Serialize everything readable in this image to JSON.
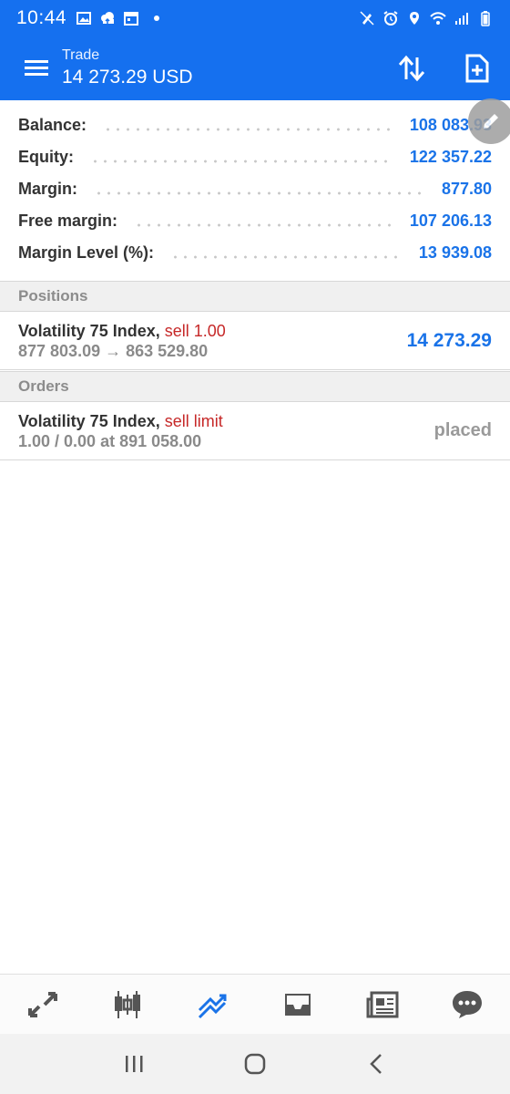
{
  "status_bar": {
    "time": "10:44",
    "left_icons": [
      "image-icon",
      "cloud-upload-icon",
      "calendar-icon",
      "notification-dot"
    ],
    "right_icons": [
      "no-pen-icon",
      "alarm-icon",
      "location-icon",
      "wifi-icon",
      "signal-icon",
      "battery-icon"
    ]
  },
  "toolbar": {
    "subtitle": "Trade",
    "title": "14 273.29 USD",
    "menu_icon": "hamburger-menu-icon",
    "sort_icon": "sort-arrows-icon",
    "new_order_icon": "new-document-icon",
    "accent_color": "#1570ef"
  },
  "summary": [
    {
      "label": "Balance:",
      "value": "108 083.93"
    },
    {
      "label": "Equity:",
      "value": "122 357.22"
    },
    {
      "label": "Margin:",
      "value": "877.80"
    },
    {
      "label": "Free margin:",
      "value": "107 206.13"
    },
    {
      "label": "Margin Level (%):",
      "value": "13 939.08"
    }
  ],
  "positions": {
    "header": "Positions",
    "items": [
      {
        "symbol": "Volatility 75 Index,",
        "type": "sell 1.00",
        "prices": "877 803.09 → 863 529.80",
        "profit": "14 273.29"
      }
    ]
  },
  "orders": {
    "header": "Orders",
    "items": [
      {
        "symbol": "Volatility 75 Index,",
        "type": "sell limit",
        "details": "1.00 / 0.00 at 891 058.00",
        "status": "placed"
      }
    ]
  },
  "bottom_nav": {
    "items": [
      "quotes-arrows-icon",
      "chart-candles-icon",
      "trade-icon",
      "history-inbox-icon",
      "news-icon",
      "chat-icon"
    ],
    "active": "trade-icon",
    "active_color": "#1a73e8"
  },
  "system_nav": [
    "recents-icon",
    "home-icon",
    "back-icon"
  ]
}
